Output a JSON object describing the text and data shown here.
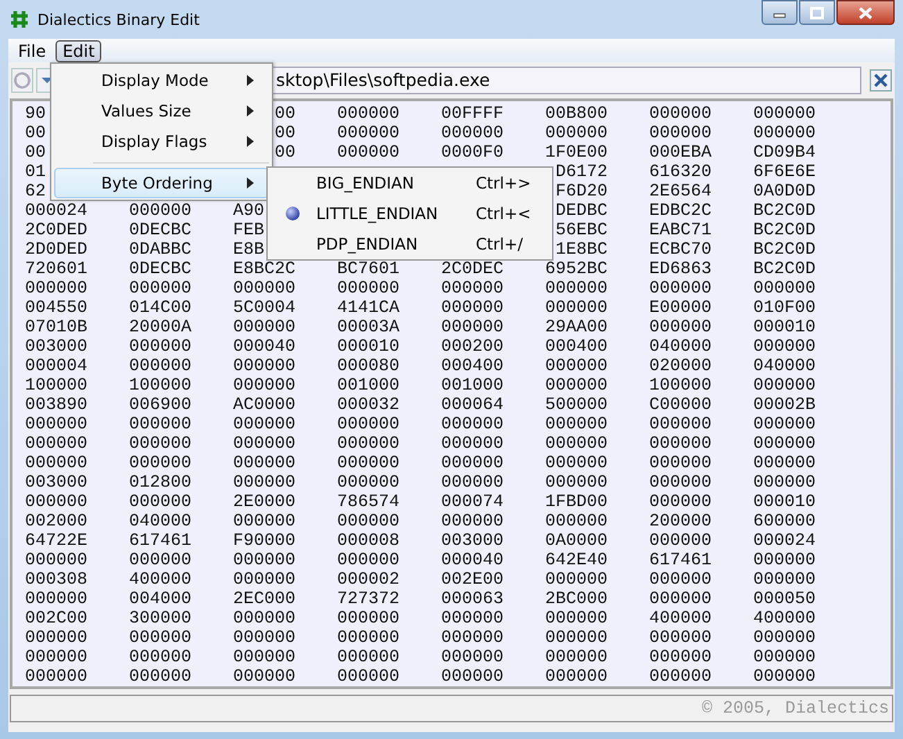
{
  "window": {
    "title": "Dialectics Binary Edit"
  },
  "menu_bar": [
    {
      "label": "File",
      "selected": false
    },
    {
      "label": "Edit",
      "selected": true
    }
  ],
  "path_field": {
    "value": "sktop\\Files\\softpedia.exe"
  },
  "edit_menu": [
    {
      "kind": "submenu",
      "label": "Display Mode",
      "highlighted": false
    },
    {
      "kind": "submenu",
      "label": "Values Size",
      "highlighted": false
    },
    {
      "kind": "submenu",
      "label": "Display Flags",
      "highlighted": false
    },
    {
      "kind": "separator"
    },
    {
      "kind": "submenu",
      "label": "Byte Ordering",
      "highlighted": true
    }
  ],
  "byte_ordering_menu": [
    {
      "label": "BIG_ENDIAN",
      "shortcut": "Ctrl+>",
      "selected": false
    },
    {
      "label": "LITTLE_ENDIAN",
      "shortcut": "Ctrl+<",
      "selected": true
    },
    {
      "label": "PDP_ENDIAN",
      "shortcut": "Ctrl+/",
      "selected": false
    }
  ],
  "rows": [
    [
      "90",
      null,
      {
        "text": "00",
        "kind": "tail"
      },
      "000000",
      "00FFFF",
      "00B800",
      "000000",
      "000000"
    ],
    [
      "00",
      null,
      {
        "text": "00",
        "kind": "tail"
      },
      "000000",
      "000000",
      "000000",
      "000000",
      "000000"
    ],
    [
      "00",
      null,
      {
        "text": "00",
        "kind": "tail"
      },
      "000000",
      "0000F0",
      "1F0E00",
      "000EBA",
      "CD09B4"
    ],
    [
      "01",
      null,
      null,
      null,
      null,
      {
        "text": "D6172",
        "kind": "tail"
      },
      "616320",
      "6F6E6E"
    ],
    [
      "62",
      null,
      null,
      null,
      null,
      {
        "text": "F6D20",
        "kind": "tail"
      },
      "2E6564",
      "0A0D0D"
    ],
    [
      "000024",
      "000000",
      "A90",
      null,
      null,
      {
        "text": "DEDBC",
        "kind": "tail"
      },
      "EDBC2C",
      "BC2C0D"
    ],
    [
      "2C0DED",
      "0DECBC",
      "FEB",
      null,
      null,
      {
        "text": "56EBC",
        "kind": "tail"
      },
      "EABC71",
      "BC2C0D"
    ],
    [
      "2D0DED",
      "0DABBC",
      "E8B",
      null,
      null,
      {
        "text": "1E8BC",
        "kind": "tail"
      },
      "ECBC70",
      "BC2C0D"
    ],
    [
      "720601",
      "0DECBC",
      "E8BC2C",
      "BC7601",
      "2C0DEC",
      "6952BC",
      "ED6863",
      "BC2C0D"
    ],
    [
      "000000",
      "000000",
      "000000",
      "000000",
      "000000",
      "000000",
      "000000",
      "000000"
    ],
    [
      "004550",
      "014C00",
      "5C0004",
      "4141CA",
      "000000",
      "000000",
      "E00000",
      "010F00"
    ],
    [
      "07010B",
      "20000A",
      "000000",
      "00003A",
      "000000",
      "29AA00",
      "000000",
      "000010"
    ],
    [
      "003000",
      "000000",
      "000040",
      "000010",
      "000200",
      "000400",
      "040000",
      "000000"
    ],
    [
      "000004",
      "000000",
      "000000",
      "000080",
      "000400",
      "000000",
      "020000",
      "040000"
    ],
    [
      "100000",
      "100000",
      "000000",
      "001000",
      "001000",
      "000000",
      "100000",
      "000000"
    ],
    [
      "003890",
      "006900",
      "AC0000",
      "000032",
      "000064",
      "500000",
      "C00000",
      "00002B"
    ],
    [
      "000000",
      "000000",
      "000000",
      "000000",
      "000000",
      "000000",
      "000000",
      "000000"
    ],
    [
      "000000",
      "000000",
      "000000",
      "000000",
      "000000",
      "000000",
      "000000",
      "000000"
    ],
    [
      "000000",
      "000000",
      "000000",
      "000000",
      "000000",
      "000000",
      "000000",
      "000000"
    ],
    [
      "003000",
      "012800",
      "000000",
      "000000",
      "000000",
      "000000",
      "000000",
      "000000"
    ],
    [
      "000000",
      "000000",
      "2E0000",
      "786574",
      "000074",
      "1FBD00",
      "000000",
      "000010"
    ],
    [
      "002000",
      "040000",
      "000000",
      "000000",
      "000000",
      "000000",
      "200000",
      "600000"
    ],
    [
      "64722E",
      "617461",
      "F90000",
      "000008",
      "003000",
      "0A0000",
      "000000",
      "000024"
    ],
    [
      "000000",
      "000000",
      "000000",
      "000000",
      "000040",
      "642E40",
      "617461",
      "000000"
    ],
    [
      "000308",
      "400000",
      "000000",
      "000002",
      "002E00",
      "000000",
      "000000",
      "000000"
    ],
    [
      "000000",
      "004000",
      "2EC000",
      "727372",
      "000063",
      "2BC000",
      "000000",
      "000050"
    ],
    [
      "002C00",
      "300000",
      "000000",
      "000000",
      "000000",
      "000000",
      "400000",
      "400000"
    ],
    [
      "000000",
      "000000",
      "000000",
      "000000",
      "000000",
      "000000",
      "000000",
      "000000"
    ],
    [
      "000000",
      "000000",
      "000000",
      "000000",
      "000000",
      "000000",
      "000000",
      "000000"
    ],
    [
      "000000",
      "000000",
      "000000",
      "000000",
      "000000",
      "000000",
      "000000",
      "000000"
    ]
  ],
  "status_bar": {
    "text": "© 2005, Dialectics"
  }
}
